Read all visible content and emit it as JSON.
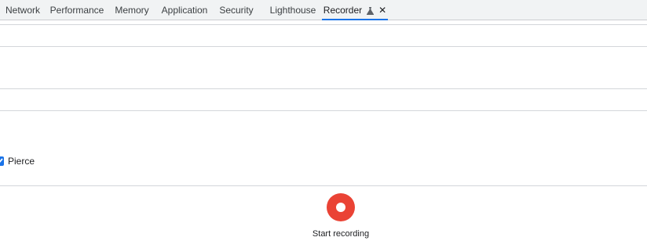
{
  "tabs": [
    {
      "label": "Network"
    },
    {
      "label": "Performance"
    },
    {
      "label": "Memory"
    },
    {
      "label": "Application"
    },
    {
      "label": "Security"
    },
    {
      "label": "Lighthouse"
    },
    {
      "label": "Recorder",
      "active": true,
      "icon": "experiment-flask-icon",
      "close": "✕"
    }
  ],
  "pierce": {
    "label": "Pierce",
    "checked": true
  },
  "recording": {
    "button_label": "Start recording",
    "color": "#ea4335"
  },
  "colors": {
    "accent": "#1a73e8",
    "tabbar_bg": "#f1f3f4"
  }
}
